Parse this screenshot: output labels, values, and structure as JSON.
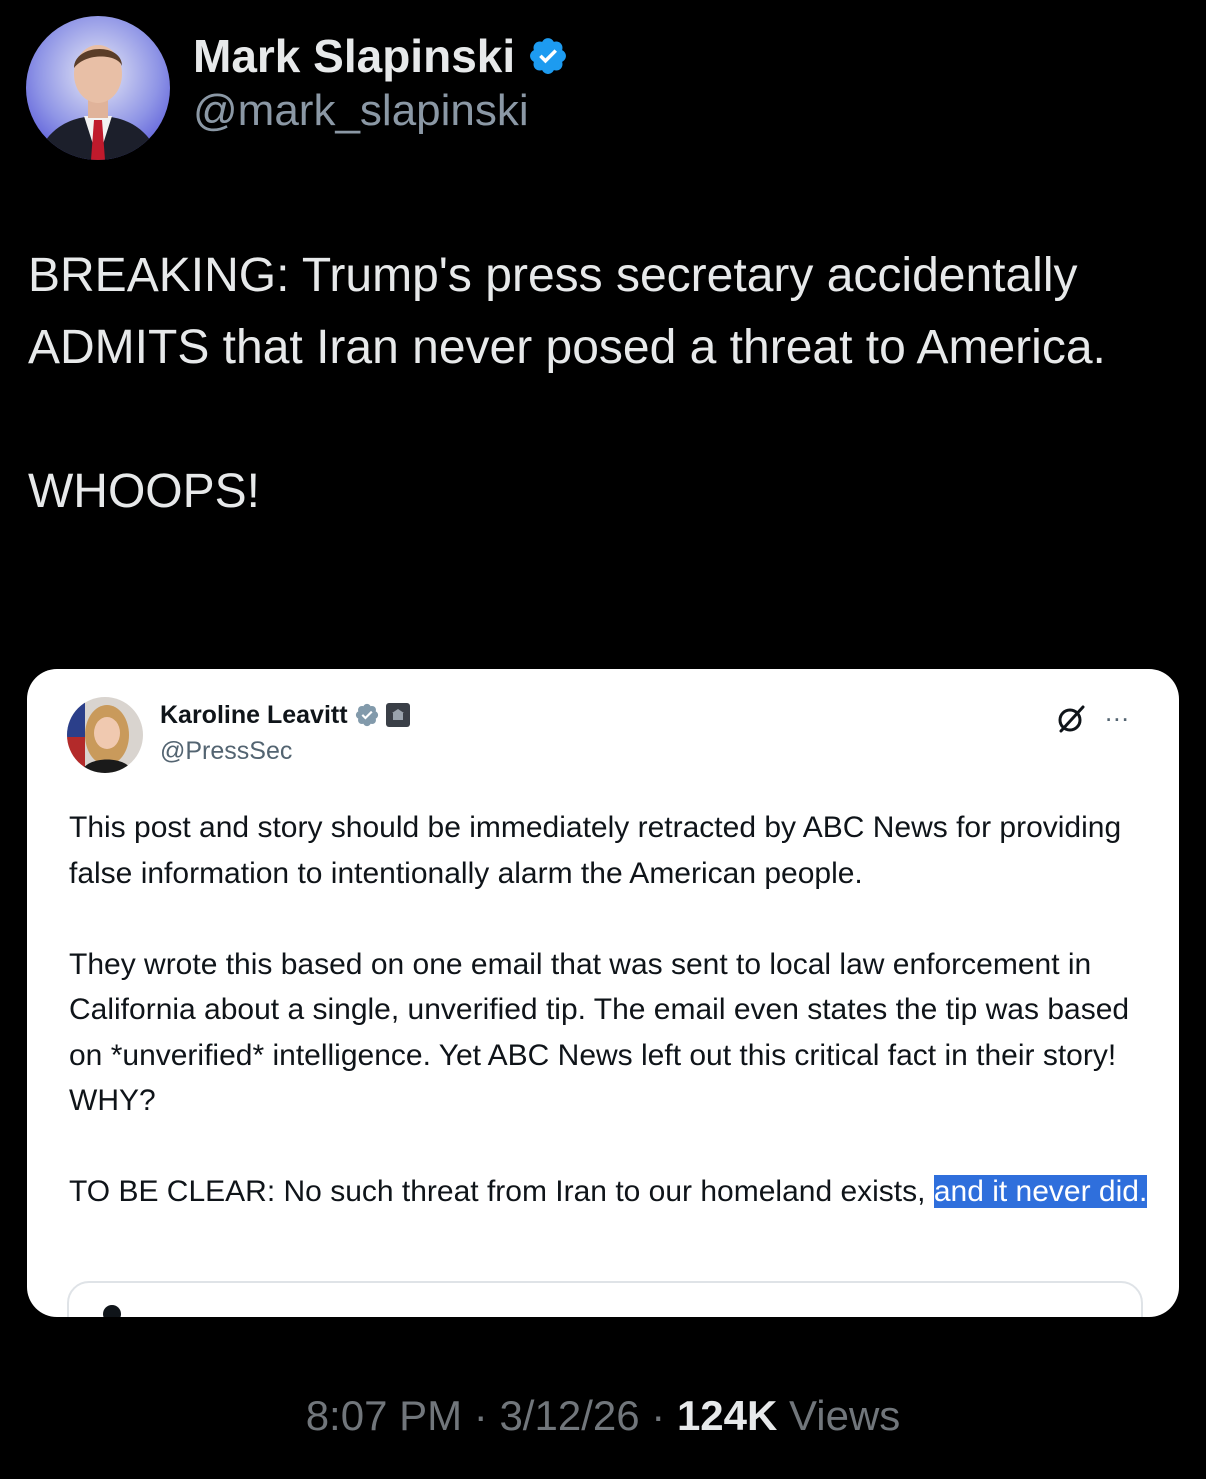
{
  "author": {
    "display_name": "Mark Slapinski",
    "handle": "@mark_slapinski",
    "verified": true
  },
  "tweet": {
    "paragraphs": [
      "BREAKING: Trump's press secretary accidentally ADMITS that Iran never posed a threat to America.",
      "WHOOPS!"
    ]
  },
  "embedded_post": {
    "display_name": "Karoline Leavitt",
    "handle": "@PressSec",
    "paragraph_1": "This post and story should be immediately retracted by ABC News for providing false information to intentionally alarm the American people.",
    "paragraph_2": "They wrote this based on one email that was sent to local law enforcement in California about a single, unverified tip. The email even states the tip was based on *unverified* intelligence. Yet ABC News left out this critical fact in their story! WHY?",
    "paragraph_3_plain": "TO BE CLEAR: No such threat from Iran to our homeland exists,",
    "paragraph_3_highlighted": "and it never did.",
    "more_icon": "..."
  },
  "meta": {
    "time": "8:07 PM",
    "separator": "·",
    "date": "3/12/26",
    "views_count": "124K",
    "views_label": "Views"
  },
  "colors": {
    "background": "#000000",
    "primary_text": "#e7e9ea",
    "secondary_text": "#71767b",
    "verified_blue": "#1d9bf0",
    "highlight": "#2f6fdc"
  },
  "icons": {
    "verified": "verified-badge-icon",
    "government": "government-badge-icon",
    "grok": "grok-icon",
    "more": "more-options-icon"
  }
}
